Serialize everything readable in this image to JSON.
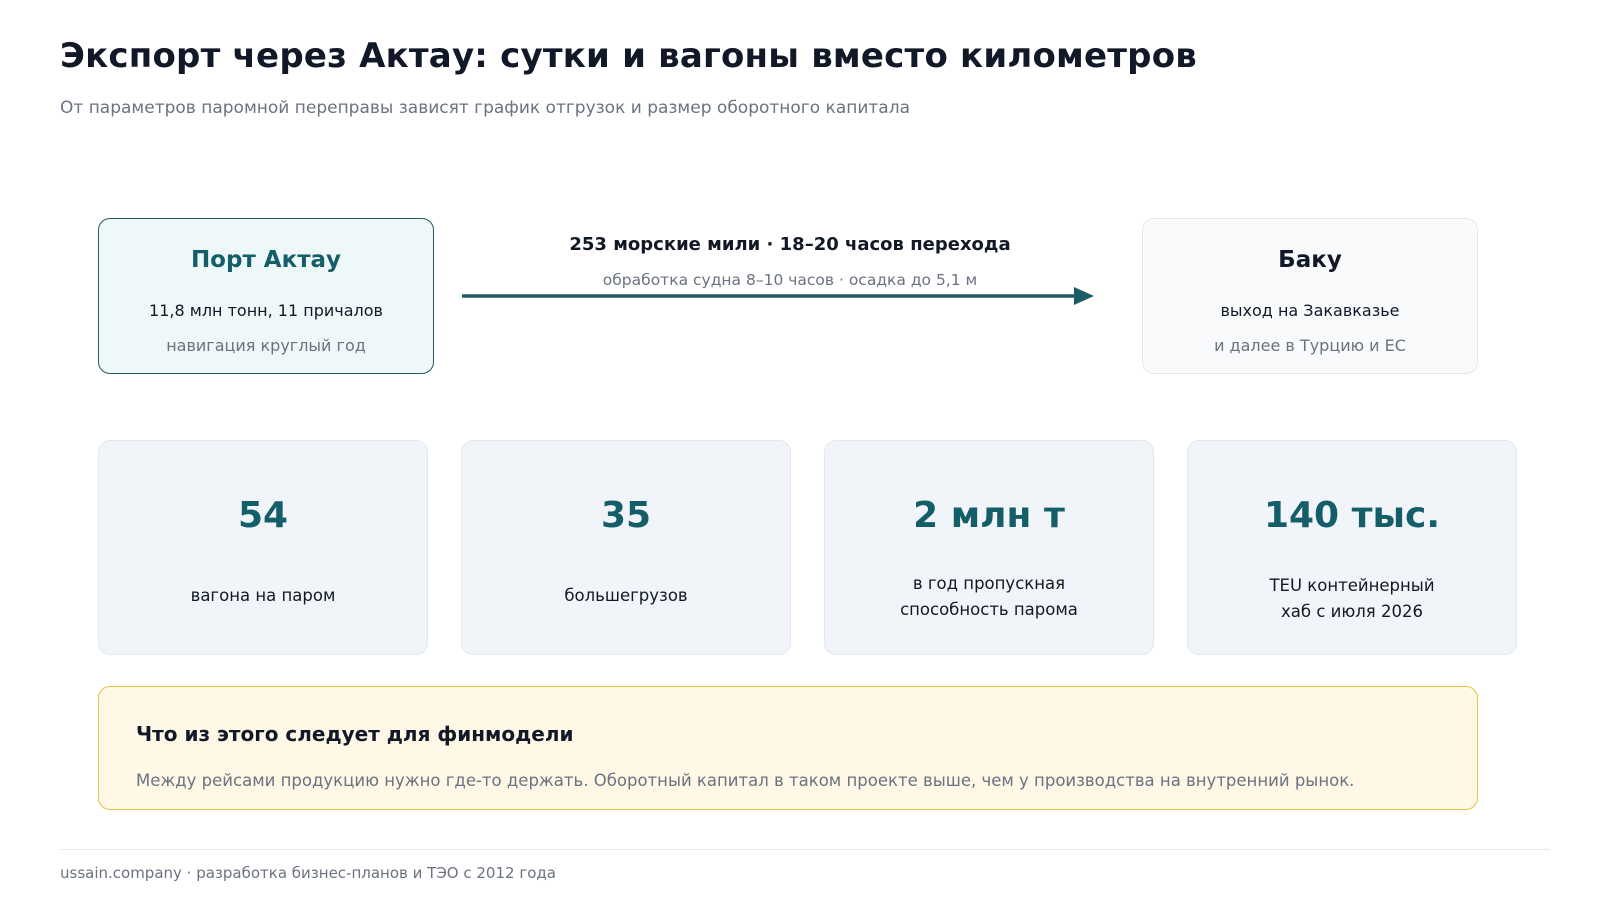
{
  "header": {
    "title": "Экспорт через Актау: сутки и вагоны вместо километров",
    "subtitle": "От параметров паромной переправы зависят график отгрузок и размер оборотного капитала"
  },
  "route": {
    "origin": {
      "title": "Порт Актау",
      "line1": "11,8 млн тонн, 11 причалов",
      "line2": "навигация круглый год"
    },
    "link": {
      "main": "253 морские мили · 18–20 часов перехода",
      "sub": "обработка судна 8–10 часов · осадка до 5,1 м"
    },
    "destination": {
      "title": "Баку",
      "line1": "выход на Закавказье",
      "line2": "и далее в Турцию и ЕС"
    }
  },
  "stats": [
    {
      "value": "54",
      "label": "вагона на паром"
    },
    {
      "value": "35",
      "label": "большегрузов"
    },
    {
      "value": "2 млн т",
      "label_line1": "в год пропускная",
      "label_line2": "способность парома"
    },
    {
      "value": "140 тыс.",
      "label_line1": "TEU контейнерный",
      "label_line2": "хаб с июля 2026"
    }
  ],
  "takeaway": {
    "title": "Что из этого следует для финмодели",
    "text": "Между рейсами продукцию нужно где-то держать. Оборотный капитал в таком проекте выше, чем у производства на внутренний рынок."
  },
  "footer": {
    "text": "ussain.company · разработка бизнес-планов и ТЭО с 2012 года"
  },
  "colors": {
    "accent": "#135e68",
    "arrow": "#1d5c66",
    "note_border": "#e8c341",
    "note_bg": "#fff8e7"
  }
}
